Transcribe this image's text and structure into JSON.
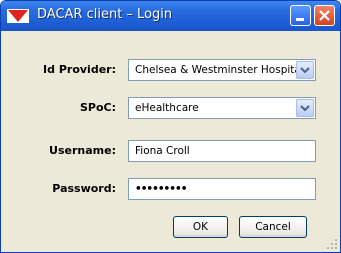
{
  "window": {
    "title": "DACAR client – Login"
  },
  "form": {
    "id_provider": {
      "label": "Id Provider:",
      "value": "Chelsea & Westminster Hospital"
    },
    "spoc": {
      "label": "SPoC:",
      "value": "eHealthcare"
    },
    "username": {
      "label": "Username:",
      "value": "Fiona Croll"
    },
    "password": {
      "label": "Password:",
      "value": "•••••••••"
    }
  },
  "buttons": {
    "ok": "OK",
    "cancel": "Cancel"
  },
  "colors": {
    "titlebar": "#1d5fd6",
    "window_bg": "#ece9d8",
    "field_border": "#7f9db9",
    "logo": "#e0231e"
  }
}
